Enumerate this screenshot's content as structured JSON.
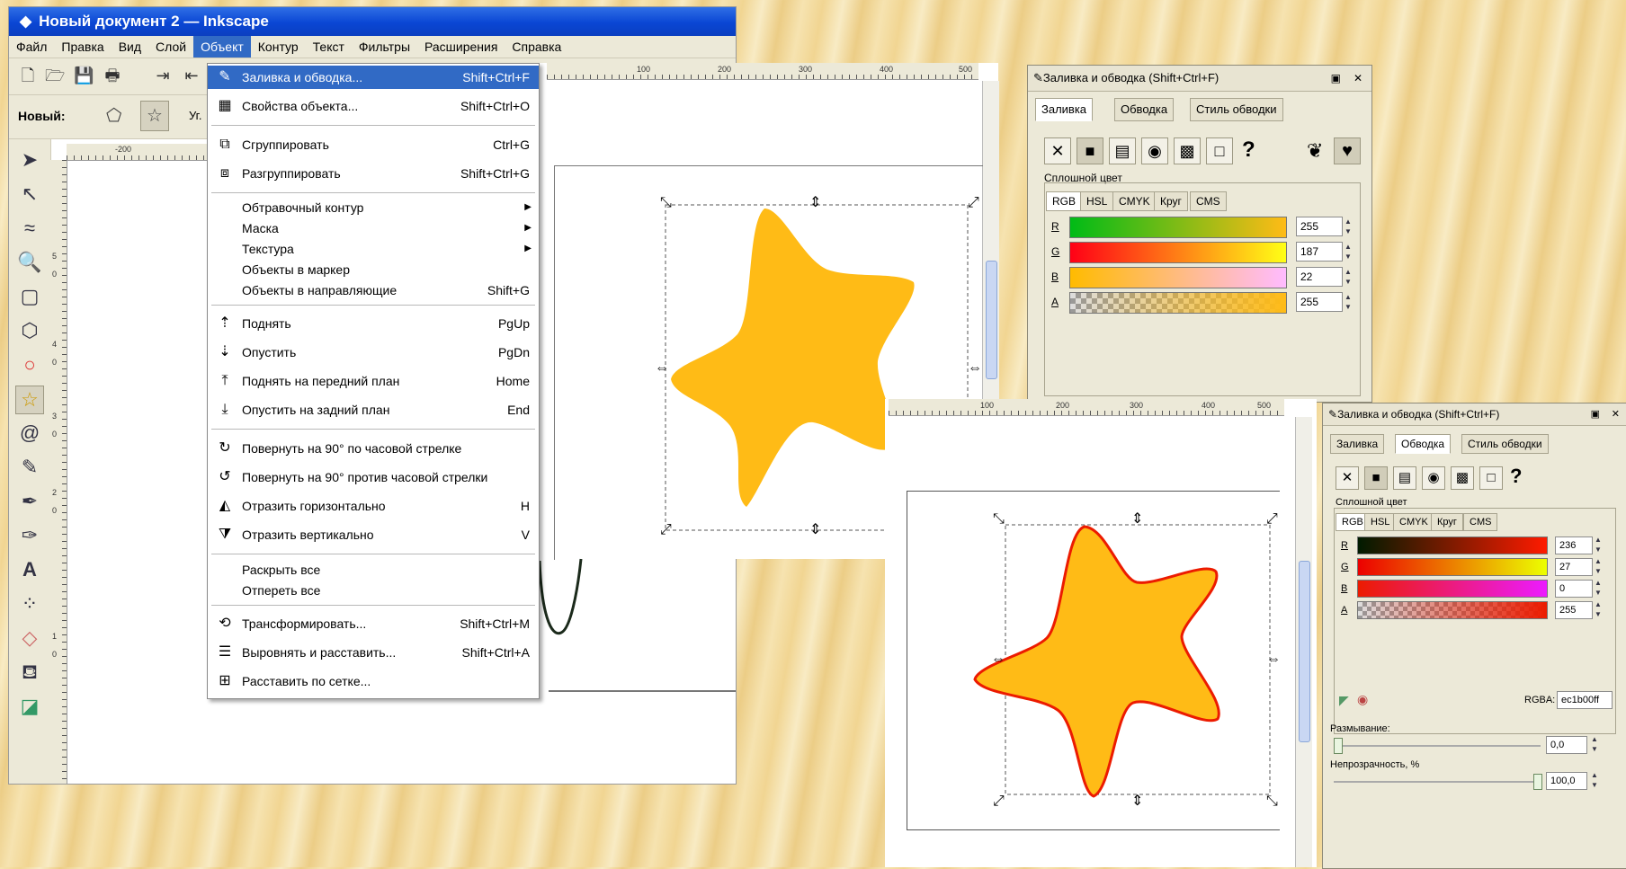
{
  "window": {
    "title": "Новый документ 2 — Inkscape"
  },
  "menubar": [
    "Файл",
    "Правка",
    "Вид",
    "Слой",
    "Объект",
    "Контур",
    "Текст",
    "Фильтры",
    "Расширения",
    "Справка"
  ],
  "ctrlbar": {
    "new_label": "Новый:",
    "angle_label": "Уг."
  },
  "ruler": {
    "h": [
      "-200",
      "100",
      "200",
      "300",
      "400",
      "500"
    ],
    "v": [
      "5",
      "0",
      "4",
      "0",
      "3",
      "0",
      "2",
      "0",
      "1",
      "0"
    ]
  },
  "object_menu": {
    "items": [
      {
        "label": "Заливка и обводка...",
        "shortcut": "Shift+Ctrl+F",
        "icon": "fill-stroke-icon"
      },
      {
        "label": "Свойства объекта...",
        "shortcut": "Shift+Ctrl+O",
        "icon": "object-properties-icon"
      },
      {
        "label": "Сгруппировать",
        "shortcut": "Ctrl+G",
        "icon": "group-icon"
      },
      {
        "label": "Разгруппировать",
        "shortcut": "Shift+Ctrl+G",
        "icon": "ungroup-icon"
      },
      {
        "label": "Обтравочный контур",
        "shortcut": "",
        "icon": ""
      },
      {
        "label": "Маска",
        "shortcut": "",
        "icon": ""
      },
      {
        "label": "Текстура",
        "shortcut": "",
        "icon": ""
      },
      {
        "label": "Объекты в маркер",
        "shortcut": "",
        "icon": ""
      },
      {
        "label": "Объекты в направляющие",
        "shortcut": "Shift+G",
        "icon": ""
      },
      {
        "label": "Поднять",
        "shortcut": "PgUp",
        "icon": "raise-icon"
      },
      {
        "label": "Опустить",
        "shortcut": "PgDn",
        "icon": "lower-icon"
      },
      {
        "label": "Поднять на передний план",
        "shortcut": "Home",
        "icon": "raise-to-top-icon"
      },
      {
        "label": "Опустить на задний план",
        "shortcut": "End",
        "icon": "lower-to-bottom-icon"
      },
      {
        "label": "Повернуть на 90° по часовой стрелке",
        "shortcut": "",
        "icon": "rotate-cw-icon"
      },
      {
        "label": "Повернуть на 90° против часовой стрелки",
        "shortcut": "",
        "icon": "rotate-ccw-icon"
      },
      {
        "label": "Отразить горизонтально",
        "shortcut": "H",
        "icon": "flip-horizontal-icon"
      },
      {
        "label": "Отразить вертикально",
        "shortcut": "V",
        "icon": "flip-vertical-icon"
      },
      {
        "label": "Раскрыть все",
        "shortcut": "",
        "icon": ""
      },
      {
        "label": "Отпереть все",
        "shortcut": "",
        "icon": ""
      },
      {
        "label": "Трансформировать...",
        "shortcut": "Shift+Ctrl+M",
        "icon": "transform-icon"
      },
      {
        "label": "Выровнять и расставить...",
        "shortcut": "Shift+Ctrl+A",
        "icon": "align-icon"
      },
      {
        "label": "Расставить по сетке...",
        "shortcut": "",
        "icon": "grid-arrange-icon"
      }
    ]
  },
  "panel1": {
    "title": "Заливка и обводка (Shift+Ctrl+F)",
    "tabs": [
      "Заливка",
      "Обводка",
      "Стиль обводки"
    ],
    "group_label": "Сплошной цвет",
    "mode_tabs": [
      "RGB",
      "HSL",
      "CMYK",
      "Круг",
      "CMS"
    ],
    "channels": [
      {
        "name": "R",
        "value": "255"
      },
      {
        "name": "G",
        "value": "187"
      },
      {
        "name": "B",
        "value": "22"
      },
      {
        "name": "A",
        "value": "255"
      }
    ]
  },
  "panel2": {
    "title": "Заливка и обводка (Shift+Ctrl+F)",
    "tabs": [
      "Заливка",
      "Обводка",
      "Стиль обводки"
    ],
    "group_label": "Сплошной цвет",
    "mode_tabs": [
      "RGB",
      "HSL",
      "CMYK",
      "Круг",
      "CMS"
    ],
    "channels": [
      {
        "name": "R",
        "value": "236"
      },
      {
        "name": "G",
        "value": "27"
      },
      {
        "name": "B",
        "value": "0"
      },
      {
        "name": "A",
        "value": "255"
      }
    ],
    "rgba_label": "RGBA:",
    "rgba_value": "ec1b00ff",
    "blur_label": "Размывание:",
    "blur_value": "0,0",
    "opacity_label": "Непрозрачность, %",
    "opacity_value": "100,0"
  },
  "colors": {
    "star_fill": "#ffbb16",
    "stroke": "#ec1b00",
    "highlight": "#316ac5"
  }
}
